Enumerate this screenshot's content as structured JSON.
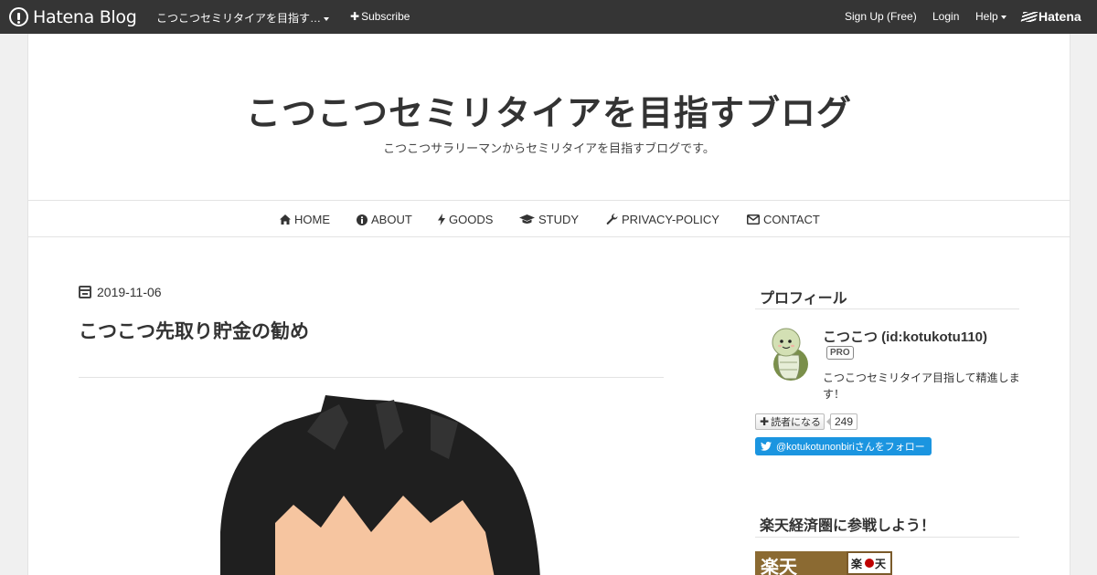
{
  "topbar": {
    "logo_text": "Hatena Blog",
    "blog_name": "こつこつセミリタイアを目指す…",
    "subscribe": "Subscribe",
    "signup": "Sign Up (Free)",
    "login": "Login",
    "help": "Help",
    "hatena": "Hatena"
  },
  "header": {
    "title": "こつこつセミリタイアを目指すブログ",
    "description": "こつこつサラリーマンからセミリタイアを目指すブログです。"
  },
  "nav": {
    "items": [
      {
        "label": "HOME",
        "icon": "home-icon"
      },
      {
        "label": "ABOUT",
        "icon": "info-icon"
      },
      {
        "label": "GOODS",
        "icon": "bolt-icon"
      },
      {
        "label": "STUDY",
        "icon": "graduation-cap-icon"
      },
      {
        "label": "PRIVACY-POLICY",
        "icon": "wrench-icon"
      },
      {
        "label": "CONTACT",
        "icon": "envelope-icon"
      }
    ]
  },
  "entry": {
    "date": "2019-11-06",
    "title": "こつこつ先取り貯金の勧め"
  },
  "sidebar": {
    "profile_heading": "プロフィール",
    "name": "こつこつ (id:kotukotu110)",
    "badge": "PRO",
    "description": "こつこつセミリタイア目指して精進します！",
    "reader_button": "読者になる",
    "reader_count": "249",
    "twitter_button": "@kotukotunonbiriさんをフォロー",
    "rakuten_heading": "楽天経済圏に参戦しよう！"
  },
  "colors": {
    "topbar_bg": "#353535",
    "twitter_blue": "#1b95e0"
  }
}
